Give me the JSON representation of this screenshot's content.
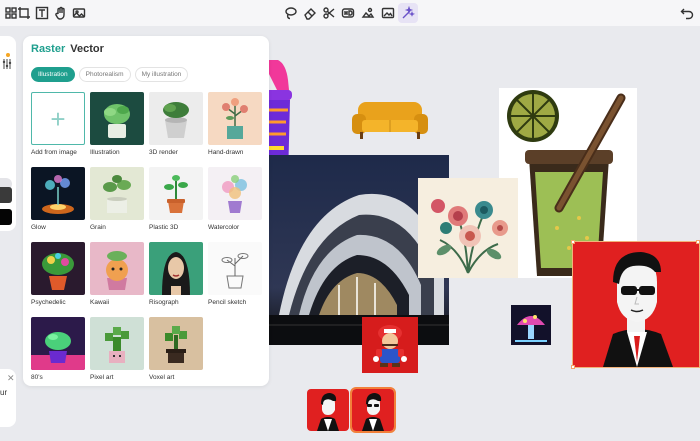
{
  "toolbar": {
    "left_tools": [
      {
        "icon": "grid-tool-icon"
      },
      {
        "icon": "crop-tool-icon"
      },
      {
        "icon": "text-tool-icon"
      },
      {
        "icon": "hand-tool-icon"
      },
      {
        "icon": "image-tool-icon"
      }
    ],
    "center_tools": [
      {
        "icon": "lasso-tool-icon"
      },
      {
        "icon": "eraser-tool-icon"
      },
      {
        "icon": "scissors-tool-icon"
      },
      {
        "icon": "hd-upscale-icon"
      },
      {
        "icon": "background-tool-icon"
      },
      {
        "icon": "picture-tool-icon"
      },
      {
        "icon": "magic-wand-icon",
        "active": true
      }
    ],
    "right_tools": [
      {
        "icon": "undo-icon"
      }
    ]
  },
  "panel": {
    "tab_raster": "Raster",
    "tab_vector": "Vector",
    "chips": [
      "Illustration",
      "Photorealism",
      "My illustration"
    ],
    "active_chip": "Illustration",
    "styles": [
      {
        "label": "Add from image"
      },
      {
        "label": "Illustration"
      },
      {
        "label": "3D render"
      },
      {
        "label": "Hand-drawn"
      },
      {
        "label": "Glow"
      },
      {
        "label": "Grain"
      },
      {
        "label": "Plastic 3D"
      },
      {
        "label": "Watercolor"
      },
      {
        "label": "Psychedelic"
      },
      {
        "label": "Kawaii"
      },
      {
        "label": "Risograph"
      },
      {
        "label": "Pencil sketch"
      },
      {
        "label": "80's"
      },
      {
        "label": "Pixel art"
      },
      {
        "label": "Voxel art"
      }
    ]
  },
  "left_panel": {
    "truncated_text": "ur"
  },
  "colors": {
    "accent": "#1f9f8e",
    "selection": "#f2a56a",
    "active_tool": "#6a52c9"
  }
}
